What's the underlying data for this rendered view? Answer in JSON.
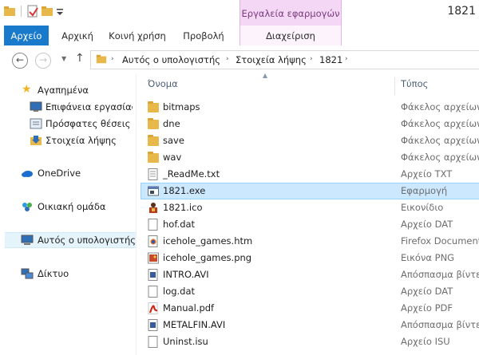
{
  "window": {
    "title": "1821",
    "context_header": "Εργαλεία εφαρμογών",
    "context_tab": "Διαχείριση"
  },
  "ribbon": {
    "tabs": [
      "Αρχείο",
      "Αρχική",
      "Κοινή χρήση",
      "Προβολή"
    ]
  },
  "address": {
    "crumbs": [
      "Αυτός ο υπολογιστής",
      "Στοιχεία λήψης",
      "1821"
    ]
  },
  "sidebar": {
    "items": [
      {
        "label": "Αγαπημένα",
        "icon": "star-icon"
      },
      {
        "label": "Επιφάνεια εργασίας",
        "icon": "desktop-icon"
      },
      {
        "label": "Πρόσφατες θέσεις",
        "icon": "recent-places-icon"
      },
      {
        "label": "Στοιχεία λήψης",
        "icon": "downloads-icon"
      },
      {
        "label": "OneDrive",
        "icon": "cloud-icon"
      },
      {
        "label": "Οικιακή ομάδα",
        "icon": "homegroup-icon"
      },
      {
        "label": "Αυτός ο υπολογιστής",
        "icon": "computer-icon"
      },
      {
        "label": "Δίκτυο",
        "icon": "network-icon"
      }
    ]
  },
  "list": {
    "col_name": "Όνομα",
    "col_type": "Τύπος",
    "files": [
      {
        "name": "bitmaps",
        "type": "Φάκελος αρχείων",
        "icon": "folder-icon"
      },
      {
        "name": "dne",
        "type": "Φάκελος αρχείων",
        "icon": "folder-icon"
      },
      {
        "name": "save",
        "type": "Φάκελος αρχείων",
        "icon": "folder-icon"
      },
      {
        "name": "wav",
        "type": "Φάκελος αρχείων",
        "icon": "folder-icon"
      },
      {
        "name": "_ReadMe.txt",
        "type": "Αρχείο TXT",
        "icon": "text-file-icon"
      },
      {
        "name": "1821.exe",
        "type": "Εφαρμογή",
        "icon": "application-icon"
      },
      {
        "name": "1821.ico",
        "type": "Εικονίδιο",
        "icon": "icon-file-icon"
      },
      {
        "name": "hof.dat",
        "type": "Αρχείο DAT",
        "icon": "file-icon"
      },
      {
        "name": "icehole_games.htm",
        "type": "Firefox Document",
        "icon": "html-file-icon"
      },
      {
        "name": "icehole_games.png",
        "type": "Εικόνα PNG",
        "icon": "image-file-icon"
      },
      {
        "name": "INTRO.AVI",
        "type": "Απόσπασμα βίντεο",
        "icon": "video-file-icon"
      },
      {
        "name": "log.dat",
        "type": "Αρχείο DAT",
        "icon": "file-icon"
      },
      {
        "name": "Manual.pdf",
        "type": "Αρχείο PDF",
        "icon": "pdf-file-icon"
      },
      {
        "name": "METALFIN.AVI",
        "type": "Απόσπασμα βίντεο",
        "icon": "video-file-icon"
      },
      {
        "name": "Uninst.isu",
        "type": "Αρχείο ISU",
        "icon": "file-icon"
      }
    ]
  },
  "colors": {
    "accent": "#1979ca",
    "selection": "#cce8ff",
    "context_tab": "#f3d7f4"
  }
}
